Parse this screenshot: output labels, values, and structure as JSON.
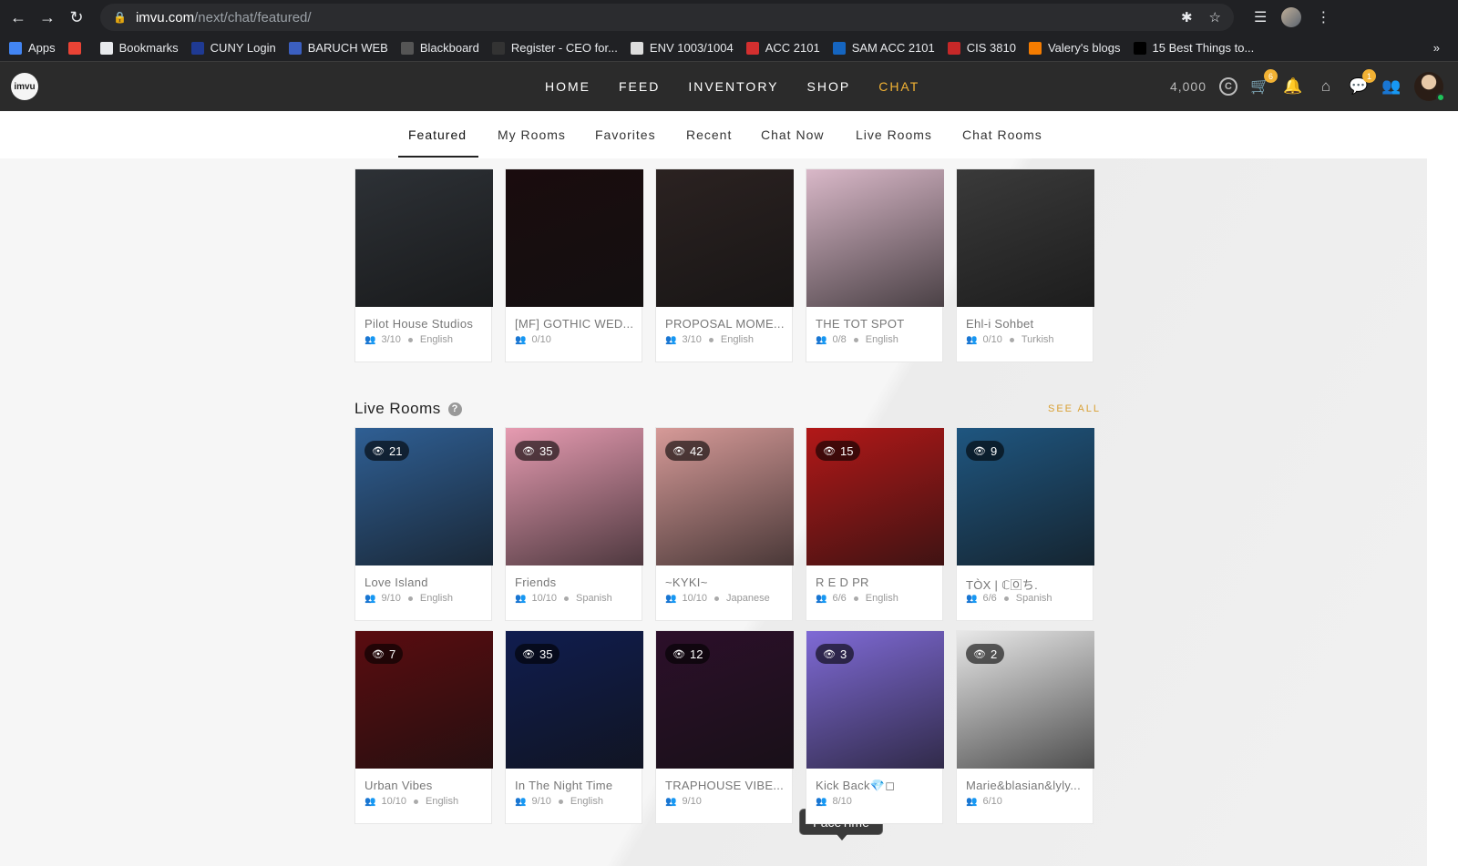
{
  "browser": {
    "url_host": "imvu.com",
    "url_path": "/next/chat/featured/",
    "bookmarks": [
      {
        "label": "Apps",
        "icon": "apps-grid-icon",
        "color": "#4285f4"
      },
      {
        "label": "",
        "icon": "pinwheel-icon",
        "color": "#ea4335"
      },
      {
        "label": "Bookmarks",
        "icon": "star-icon",
        "color": "#e8eaed"
      },
      {
        "label": "CUNY Login",
        "icon": "cuny-icon",
        "color": "#1f3a93"
      },
      {
        "label": "BARUCH WEB",
        "icon": "baruch-icon",
        "color": "#3b5fc0"
      },
      {
        "label": "Blackboard",
        "icon": "blackboard-icon",
        "color": "#555555"
      },
      {
        "label": "Register - CEO for...",
        "icon": "ceo-icon",
        "color": "#333333"
      },
      {
        "label": "ENV 1003/1004",
        "icon": "env-icon",
        "color": "#dddddd"
      },
      {
        "label": "ACC 2101",
        "icon": "mcgraw-icon",
        "color": "#d32f2f"
      },
      {
        "label": "SAM ACC 2101",
        "icon": "sam-icon",
        "color": "#1565c0"
      },
      {
        "label": "CIS 3810",
        "icon": "apple-icon",
        "color": "#c62828"
      },
      {
        "label": "Valery's blogs",
        "icon": "blogger-icon",
        "color": "#f57c00"
      },
      {
        "label": "15 Best Things to...",
        "icon": "cnt-icon",
        "color": "#000000"
      }
    ],
    "more_label": "»"
  },
  "header": {
    "nav": [
      "HOME",
      "FEED",
      "INVENTORY",
      "SHOP",
      "CHAT"
    ],
    "active_nav": "CHAT",
    "credits": "4,000",
    "coin_symbol": "C",
    "cart_badge": "6",
    "messages_badge": "1"
  },
  "subtabs": [
    "Featured",
    "My Rooms",
    "Favorites",
    "Recent",
    "Chat Now",
    "Live Rooms",
    "Chat Rooms"
  ],
  "featured_rooms": [
    {
      "name": "Pilot House Studios",
      "occupancy": "3/10",
      "language": "English",
      "bg": "#2d3136"
    },
    {
      "name": "[MF] GOTHIC WED...",
      "occupancy": "0/10",
      "language": "",
      "bg": "#1a0c0e"
    },
    {
      "name": "PROPOSAL MOME...",
      "occupancy": "3/10",
      "language": "English",
      "bg": "#2b2221"
    },
    {
      "name": "THE TOT SPOT",
      "occupancy": "0/8",
      "language": "English",
      "bg": "#d9b8c8"
    },
    {
      "name": "Ehl-i Sohbet",
      "occupancy": "0/10",
      "language": "Turkish",
      "bg": "#3a3a3a"
    }
  ],
  "live_section": {
    "title": "Live Rooms",
    "help": "?",
    "see_all": "SEE ALL"
  },
  "live_rooms": [
    {
      "name": "Love Island",
      "occupancy": "9/10",
      "language": "English",
      "viewers": "21",
      "bg": "#2f5f94"
    },
    {
      "name": "Friends",
      "occupancy": "10/10",
      "language": "Spanish",
      "viewers": "35",
      "bg": "#e69bb1"
    },
    {
      "name": "~KYKI~",
      "occupancy": "10/10",
      "language": "Japanese",
      "viewers": "42",
      "bg": "#d69a98"
    },
    {
      "name": "R E D PR",
      "occupancy": "6/6",
      "language": "English",
      "viewers": "15",
      "bg": "#b21818"
    },
    {
      "name": "TÒX | ℂ🄾ち.",
      "occupancy": "6/6",
      "language": "Spanish",
      "viewers": "9",
      "bg": "#1f5680"
    },
    {
      "name": "Urban Vibes",
      "occupancy": "10/10",
      "language": "English",
      "viewers": "7",
      "bg": "#5a0c10"
    },
    {
      "name": "In The Night Time",
      "occupancy": "9/10",
      "language": "English",
      "viewers": "35",
      "bg": "#101d4f"
    },
    {
      "name": "TRAPHOUSE VIBE...",
      "occupancy": "9/10",
      "language": "",
      "viewers": "12",
      "bg": "#2c0f2a"
    },
    {
      "name": "Kick Back💎◻",
      "occupancy": "8/10",
      "language": "",
      "viewers": "3",
      "bg": "#7f6ad6"
    },
    {
      "name": "Marie&blasian&lyly...",
      "occupancy": "6/10",
      "language": "",
      "viewers": "2",
      "bg": "#e8e8e8"
    }
  ],
  "tooltip": "FaceTime"
}
